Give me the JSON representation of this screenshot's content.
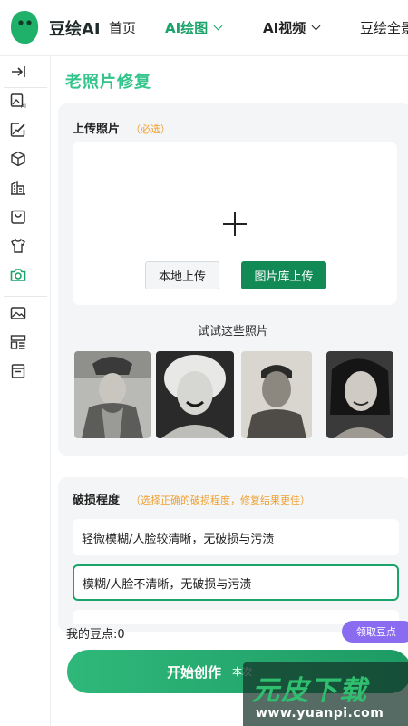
{
  "header": {
    "brand": "豆绘AI",
    "nav": {
      "home": "首页",
      "ai_draw": "AI绘图",
      "ai_video": "AI视频",
      "all": "豆绘全景"
    }
  },
  "sidebar": {
    "icons": [
      "collapse-arrow-icon",
      "image-ai-icon",
      "edit-image-icon",
      "cube-icon",
      "building-icon",
      "bag-icon",
      "shirt-icon",
      "camera-icon",
      "picture-icon",
      "layout-icon",
      "document-icon"
    ]
  },
  "page": {
    "title": "老照片修复"
  },
  "upload": {
    "title": "上传照片",
    "required_note": "（必选）",
    "local_button": "本地上传",
    "library_button": "图片库上传"
  },
  "samples": {
    "title": "试试这些照片",
    "items": [
      "sample-photo-1",
      "sample-photo-2",
      "sample-photo-3",
      "sample-photo-4"
    ]
  },
  "damage": {
    "title": "破损程度",
    "note": "（选择正确的破损程度，修复结果更佳）",
    "options": [
      "轻微模糊/人脸较清晰，无破损与污渍",
      "模糊/人脸不清晰，无破损与污渍"
    ],
    "selected_index": 1
  },
  "footer": {
    "beans": "我的豆点:0",
    "get_beans": "领取豆点",
    "start": "开始创作",
    "start_sub": "本次"
  },
  "watermark": {
    "text": "元皮下载",
    "url": "www.yuanpi.com"
  },
  "colors": {
    "accent": "#1aa36a",
    "title_green": "#32c48a",
    "note_orange": "#f0a030",
    "purple": "#8a6cf0"
  }
}
